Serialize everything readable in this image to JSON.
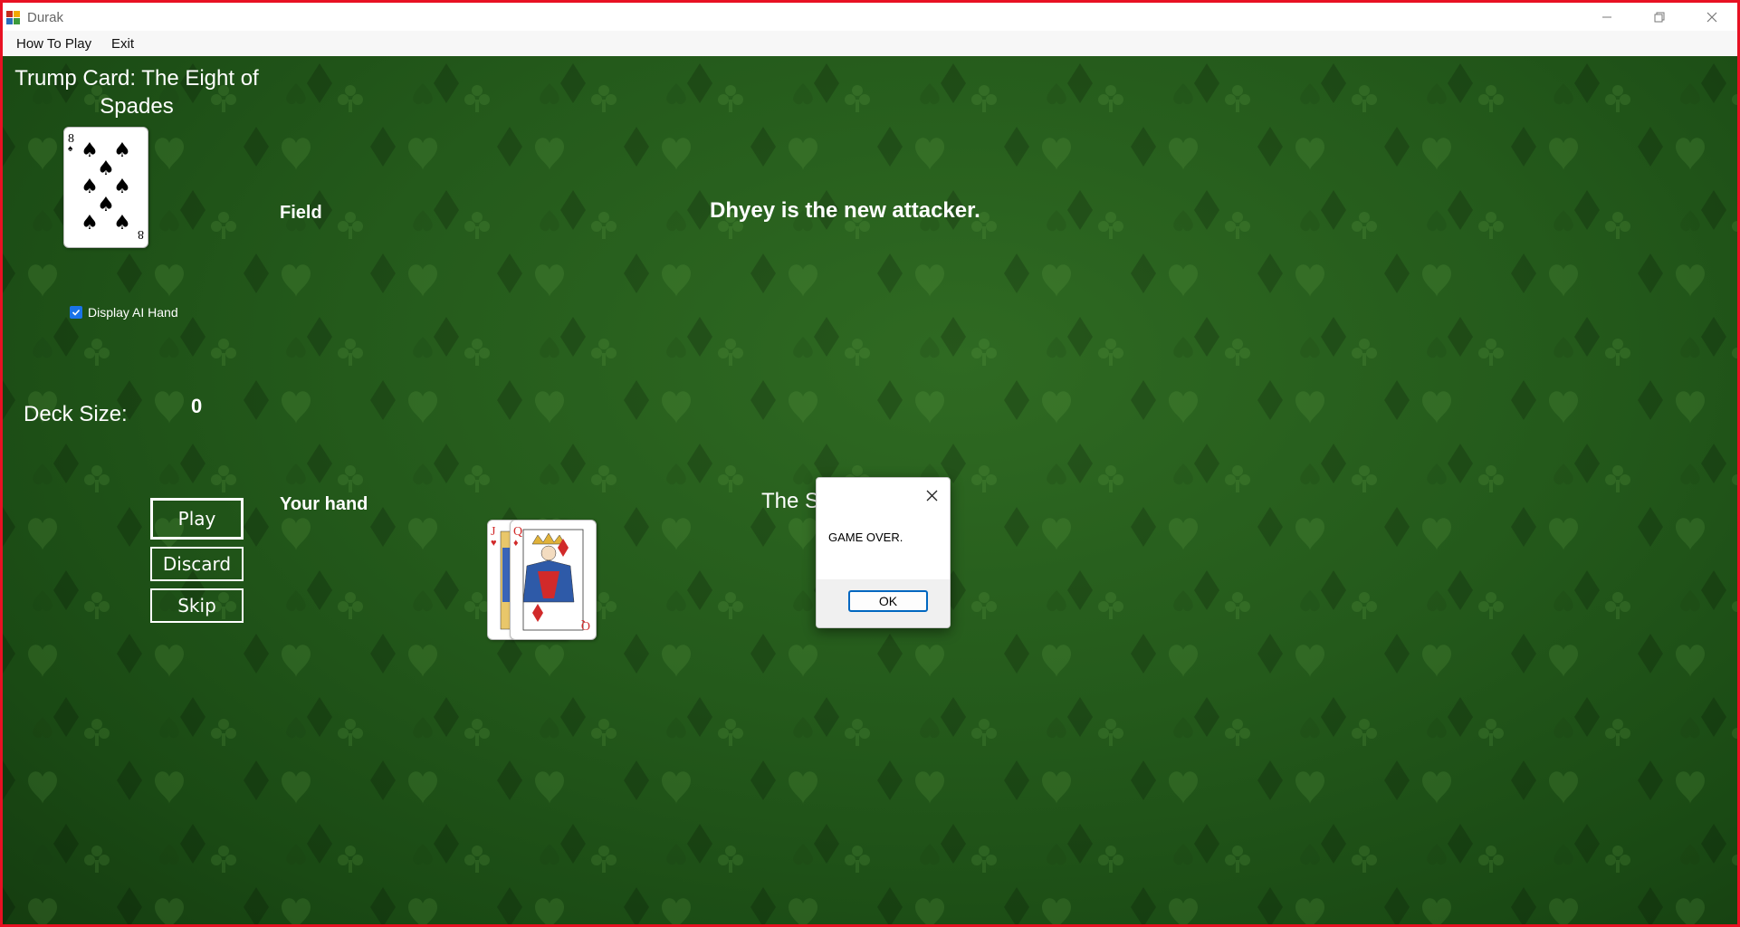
{
  "window": {
    "title": "Durak",
    "icon": "durak-app-icon",
    "controls": [
      "minimize-icon",
      "restore-icon",
      "close-icon"
    ]
  },
  "menu": {
    "items": [
      "How To Play",
      "Exit"
    ]
  },
  "trump": {
    "title": "Trump Card: The Eight of Spades",
    "card": {
      "rank": "8",
      "suit": "spades",
      "suit_symbol": "♠",
      "color": "#000000"
    }
  },
  "field": {
    "label": "Field"
  },
  "status": {
    "message": "Dhyey is the new attacker."
  },
  "options": {
    "display_ai_hand_label": "Display AI Hand",
    "display_ai_hand_checked": true
  },
  "deck": {
    "label": "Deck Size:",
    "value": "0"
  },
  "actions": {
    "play": "Play",
    "discard": "Discard",
    "skip": "Skip"
  },
  "hand": {
    "label": "Your hand",
    "cards": [
      {
        "rank": "J",
        "suit": "hearts",
        "suit_symbol": "♥",
        "color": "#d12a2a"
      },
      {
        "rank": "Q",
        "suit": "diamonds",
        "suit_symbol": "♦",
        "color": "#d12a2a"
      }
    ]
  },
  "partial_label": {
    "visible_text": "The S"
  },
  "dialog": {
    "message": "GAME OVER.",
    "ok_label": "OK"
  },
  "colors": {
    "table_green": "#245a1b",
    "frame_red": "#e81123",
    "dialog_accent": "#0067c0"
  }
}
